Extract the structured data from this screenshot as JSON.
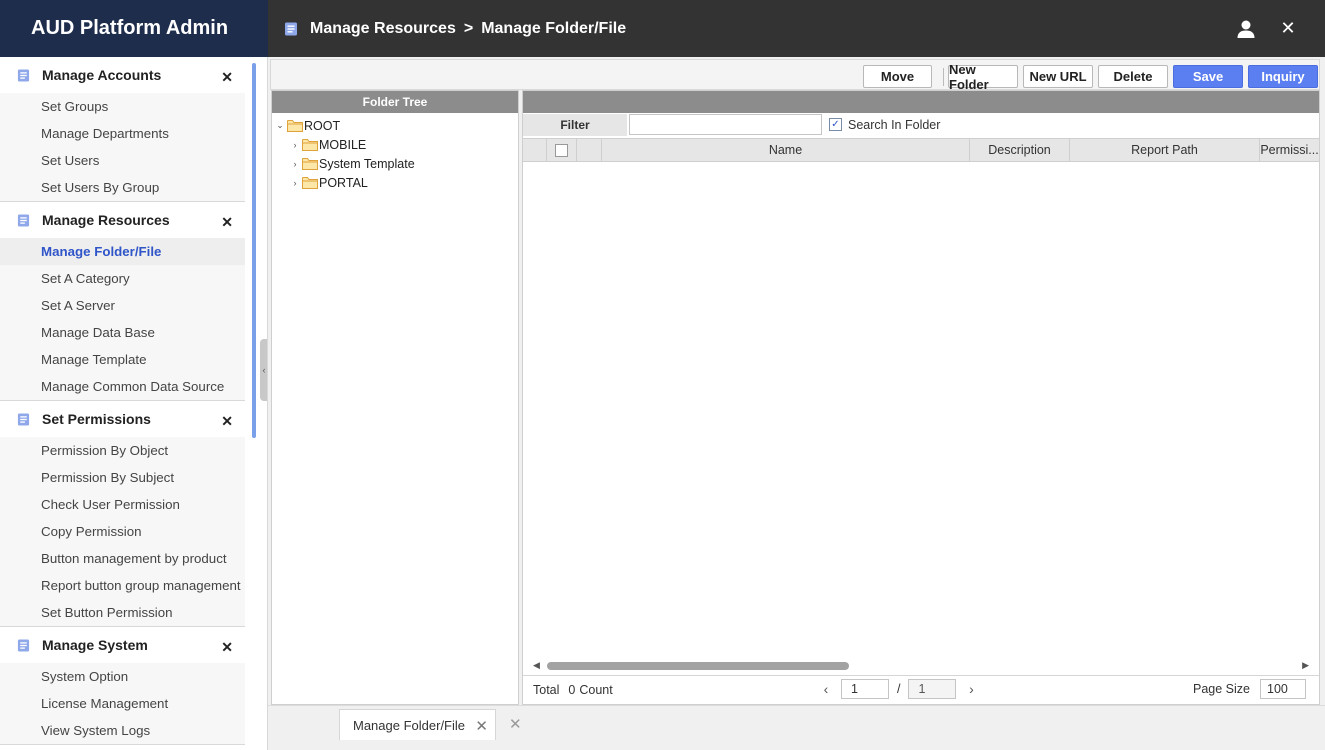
{
  "app": {
    "title": "AUD Platform Admin"
  },
  "topbar": {
    "breadcrumb_parent": "Manage Resources",
    "breadcrumb_separator": ">",
    "breadcrumb_current": "Manage Folder/File",
    "user_icon": "user-icon",
    "close_icon": "close-icon",
    "background": "#333333"
  },
  "sidebar": {
    "header_background": "#1f2d4d",
    "active_color": "#2f55c9",
    "groups": [
      {
        "title": "Manage Accounts",
        "items": [
          "Set Groups",
          "Manage Departments",
          "Set Users",
          "Set Users By Group"
        ]
      },
      {
        "title": "Manage Resources",
        "items": [
          "Manage Folder/File",
          "Set A Category",
          "Set A Server",
          "Manage Data Base",
          "Manage Template",
          "Manage Common Data Source"
        ],
        "active_item": "Manage Folder/File"
      },
      {
        "title": "Set Permissions",
        "items": [
          "Permission By Object",
          "Permission By Subject",
          "Check User Permission",
          "Copy Permission",
          "Button management by product",
          "Report button group management",
          "Set Button Permission"
        ]
      },
      {
        "title": "Manage System",
        "items": [
          "System Option",
          "License Management",
          "View System Logs"
        ]
      }
    ]
  },
  "toolbar": {
    "move": "Move",
    "new_folder": "New Folder",
    "new_url": "New URL",
    "delete": "Delete",
    "save": "Save",
    "inquiry": "Inquiry",
    "primary_color": "#5b7ff0"
  },
  "tree": {
    "header": "Folder Tree",
    "root": "ROOT",
    "children": [
      "MOBILE",
      "System Template",
      "PORTAL"
    ],
    "folder_color": "#f2b84b"
  },
  "grid": {
    "filter_label": "Filter",
    "filter_value": "",
    "search_in_folder_label": "Search In Folder",
    "search_in_folder_checked": true,
    "columns": [
      "Name",
      "Description",
      "Report Path",
      "Permissi..."
    ],
    "rows": []
  },
  "footer": {
    "total_label": "Total",
    "total_count": "0",
    "count_label": "Count",
    "current_page": "1",
    "page_separator": "/",
    "total_pages": "1",
    "page_size_label": "Page Size",
    "page_size": "100"
  },
  "tabs": [
    {
      "label": "Manage Folder/File"
    }
  ]
}
